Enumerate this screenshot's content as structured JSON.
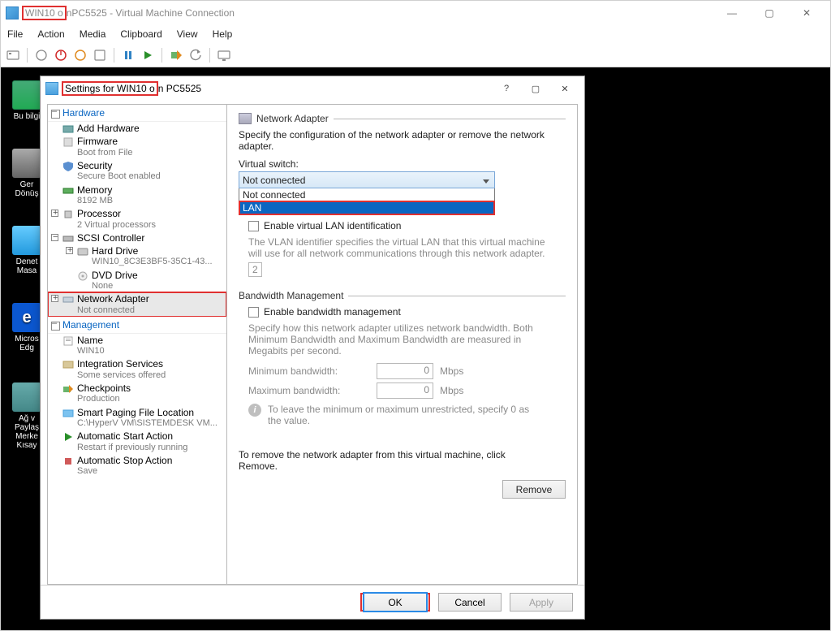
{
  "vmc": {
    "title_prefix": "WIN10 o",
    "title_mid": "n",
    "title_rest": " PC5525 - Virtual Machine Connection",
    "menu": [
      "File",
      "Action",
      "Media",
      "Clipboard",
      "View",
      "Help"
    ],
    "ctrl_min": "—",
    "ctrl_max": "▢",
    "ctrl_close": "✕"
  },
  "desktop": {
    "icons": [
      {
        "label": "Bu bilgi"
      },
      {
        "label": "Ger\nDönüş"
      },
      {
        "label": "Denet\nMasa"
      },
      {
        "label": "Micros\nEdg"
      },
      {
        "label": "Ağ v\nPaylaş\nMerke\nKısay"
      }
    ]
  },
  "dlg": {
    "title_hl": "Settings for WIN10 o",
    "title_rest": "n PC5525",
    "ctrl_help": "?",
    "ctrl_max": "▢",
    "ctrl_close": "✕",
    "cat_hardware": "Hardware",
    "cat_management": "Management",
    "tree": {
      "add_hw": "Add Hardware",
      "firmware": "Firmware",
      "firmware_sub": "Boot from File",
      "security": "Security",
      "security_sub": "Secure Boot enabled",
      "memory": "Memory",
      "memory_sub": "8192 MB",
      "processor": "Processor",
      "processor_sub": "2 Virtual processors",
      "scsi": "SCSI Controller",
      "hdd": "Hard Drive",
      "hdd_sub": "WIN10_8C3E3BF5-35C1-43...",
      "dvd": "DVD Drive",
      "dvd_sub": "None",
      "netadapter": "Network Adapter",
      "netadapter_sub": "Not connected",
      "name": "Name",
      "name_sub": "WIN10",
      "integ": "Integration Services",
      "integ_sub": "Some services offered",
      "chk": "Checkpoints",
      "chk_sub": "Production",
      "smart": "Smart Paging File Location",
      "smart_sub": "C:\\HyperV VM\\SISTEMDESK VM...",
      "astart": "Automatic Start Action",
      "astart_sub": "Restart if previously running",
      "astop": "Automatic Stop Action",
      "astop_sub": "Save"
    },
    "panel": {
      "heading": "Network Adapter",
      "desc": "Specify the configuration of the network adapter or remove the network adapter.",
      "vswitch_lbl": "Virtual switch:",
      "vswitch_value": "Not connected",
      "options": [
        "Not connected",
        "LAN"
      ],
      "vlan_chk": "Enable virtual LAN identification",
      "vlan_id": "2",
      "vlan_help": "The VLAN identifier specifies the virtual LAN that this virtual machine will use for all network communications through this network adapter.",
      "bw_heading": "Bandwidth Management",
      "bw_chk": "Enable bandwidth management",
      "bw_help": "Specify how this network adapter utilizes network bandwidth. Both Minimum Bandwidth and Maximum Bandwidth are measured in Megabits per second.",
      "bw_min_lbl": "Minimum bandwidth:",
      "bw_min": "0",
      "mbps": "Mbps",
      "bw_max_lbl": "Maximum bandwidth:",
      "bw_max": "0",
      "bw_info": "To leave the minimum or maximum unrestricted, specify 0 as the value.",
      "remove_txt": "To remove the network adapter from this virtual machine, click Remove.",
      "remove_btn": "Remove"
    },
    "footer": {
      "ok": "OK",
      "cancel": "Cancel",
      "apply": "Apply"
    }
  }
}
